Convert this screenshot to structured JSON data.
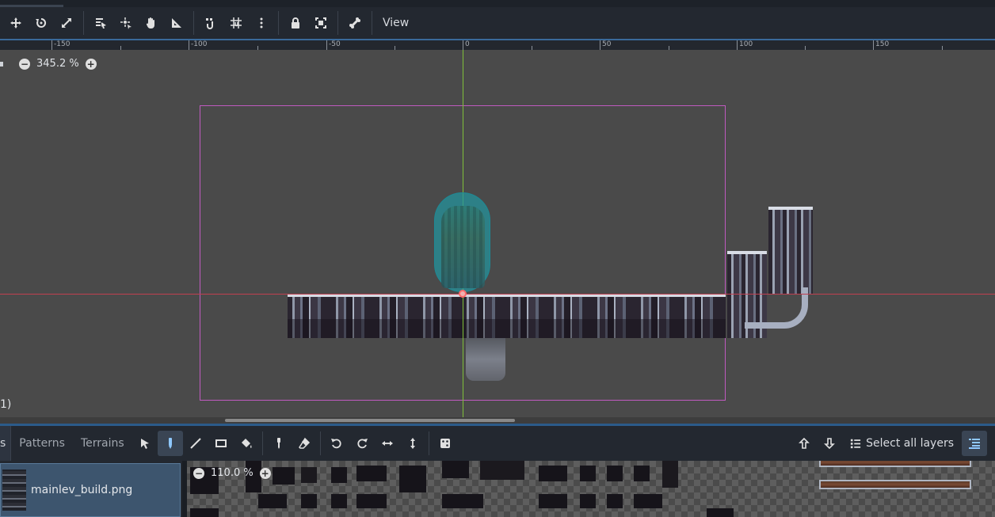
{
  "toolbar": {
    "items": [
      "move-mode",
      "rotate-mode",
      "scale-mode",
      "select-list",
      "pivot",
      "pan-mode",
      "ruler-mode",
      "smart-snap",
      "grid-snap",
      "more-options",
      "lock",
      "group",
      "bone",
      "view"
    ],
    "view_label": "View"
  },
  "ruler": {
    "labels": [
      "-150",
      "-100",
      "-50",
      "0",
      "50",
      "100",
      "150"
    ]
  },
  "viewport": {
    "zoom_level": "345.2 %",
    "zoom_minus": "−",
    "zoom_plus": "+",
    "fragment_text": "1)"
  },
  "bottom_panel": {
    "tabs": [
      "s",
      "Patterns",
      "Terrains"
    ],
    "tools": [
      "select-tool",
      "paint-tool",
      "line-tool",
      "rect-tool",
      "bucket-tool",
      "picker-tool",
      "eraser-tool",
      "rotate-left",
      "rotate-right",
      "flip-h",
      "flip-v",
      "random-tile"
    ],
    "select_all_layers": "Select all layers"
  },
  "tileset": {
    "source_name": "mainlev_build.png",
    "atlas_zoom": "110.0 %",
    "zoom_minus": "−",
    "zoom_plus": "+"
  },
  "colors": {
    "accent": "#4a9eff",
    "frame": "#c05ac0",
    "x_axis": "#c04050",
    "y_axis": "#7fbf3a",
    "collider": "#2396a0"
  }
}
